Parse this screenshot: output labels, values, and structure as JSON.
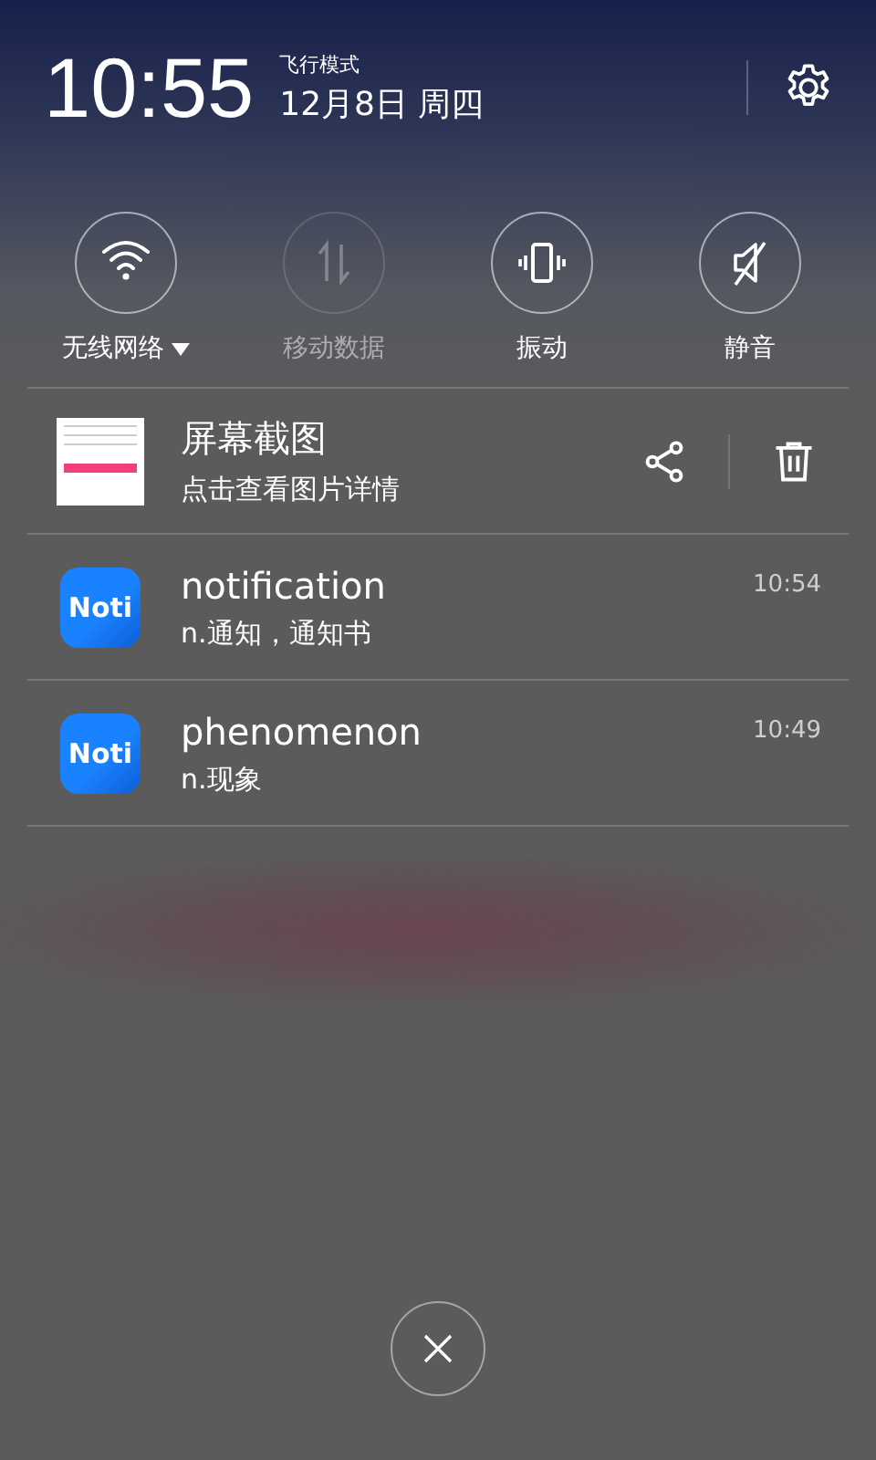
{
  "header": {
    "time": "10:55",
    "mode": "飞行模式",
    "date": "12月8日 周四"
  },
  "toggles": [
    {
      "kind": "wifi",
      "label": "无线网络",
      "menu": true,
      "disabled": false
    },
    {
      "kind": "data",
      "label": "移动数据",
      "menu": false,
      "disabled": true
    },
    {
      "kind": "vibrate",
      "label": "振动",
      "menu": false,
      "disabled": false
    },
    {
      "kind": "mute",
      "label": "静音",
      "menu": false,
      "disabled": false
    }
  ],
  "notifications": [
    {
      "kind": "screenshot",
      "title": "屏幕截图",
      "text": "点击查看图片详情"
    },
    {
      "kind": "app",
      "app_logo": "Noti",
      "title": "notification",
      "text": "n.通知，通知书",
      "time": "10:54"
    },
    {
      "kind": "app",
      "app_logo": "Noti",
      "title": "phenomenon",
      "text": "n.现象",
      "time": "10:49"
    }
  ]
}
